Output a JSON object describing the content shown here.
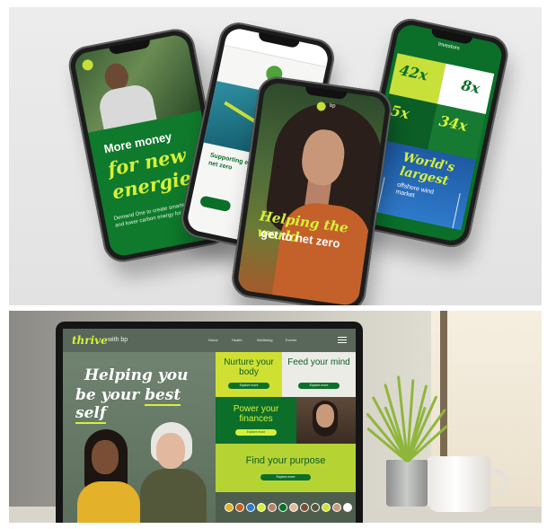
{
  "phones": {
    "phone1": {
      "line1": "More money",
      "line2": "for new",
      "line3": "energies",
      "body": "Demand One to create smarter, safer and lower carbon energy for 1 million of"
    },
    "phone2": {
      "headline": "Supporting efforts to reach net zero",
      "cta": "Learn more"
    },
    "phone3": {
      "brand": "bp",
      "line1": "Helping the world",
      "line2": "get to net zero"
    },
    "phone4": {
      "title": "Investors",
      "stats": [
        "42x",
        "8x",
        "5x",
        "34x"
      ],
      "highlight1": "World's",
      "highlight2": "largest",
      "highlight3": "offshore wind market"
    }
  },
  "laptop": {
    "brand": "thrive",
    "brand_suffix": "with bp",
    "nav": [
      "Home",
      "Health",
      "Wellbeing",
      "Events"
    ],
    "hero_line1": "Helping you",
    "hero_line2_prefix": "be your",
    "hero_line2_highlight": "best self",
    "tiles": {
      "body": {
        "title": "Nurture your body",
        "button": "Explore more"
      },
      "mind": {
        "title": "Feed your mind",
        "button": "Explore more"
      },
      "finances": {
        "title": "Power your finances",
        "button": "Explore more"
      },
      "purpose": {
        "title": "Find your purpose",
        "button": "Explore more"
      }
    },
    "avatar_colors": [
      "#e3b12a",
      "#c4612a",
      "#2f7acb",
      "#d6f03a",
      "#b88268",
      "#0b6f2a",
      "#e2b99e",
      "#7a4e35",
      "#54583a",
      "#d0e033",
      "#c99a7a",
      "#ffffff"
    ]
  }
}
